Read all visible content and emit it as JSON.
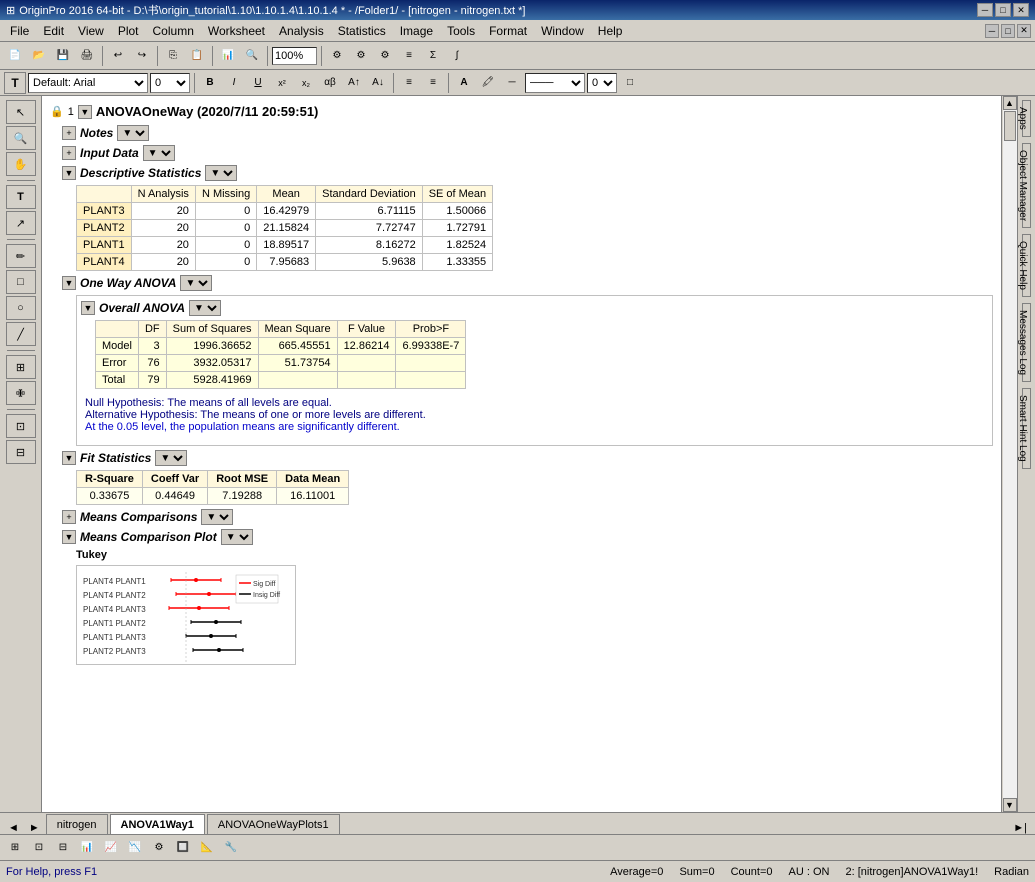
{
  "titlebar": {
    "title": "OriginPro 2016 64-bit - D:\\书\\origin_tutorial\\1.10\\1.10.1.4\\1.10.1.4 * - /Folder1/ - [nitrogen - nitrogen.txt *]",
    "app_icon": "⊞",
    "minimize": "─",
    "maximize": "□",
    "close": "✕"
  },
  "menubar": {
    "items": [
      "File",
      "Edit",
      "View",
      "Plot",
      "Column",
      "Worksheet",
      "Analysis",
      "Statistics",
      "Image",
      "Tools",
      "Format",
      "Window",
      "Help"
    ]
  },
  "toolbar": {
    "zoom_level": "100%",
    "font_name": "Default: Arial",
    "font_size": "0"
  },
  "report": {
    "title": "ANOVAOneWay (2020/7/11 20:59:51)",
    "sections": {
      "notes": {
        "label": "Notes"
      },
      "input_data": {
        "label": "Input Data"
      },
      "descriptive_statistics": {
        "label": "Descriptive Statistics",
        "columns": [
          "N Analysis",
          "N Missing",
          "Mean",
          "Standard Deviation",
          "SE of Mean"
        ],
        "rows": [
          {
            "name": "PLANT3",
            "n_analysis": 20,
            "n_missing": 0,
            "mean": "16.42979",
            "std_dev": "6.71115",
            "se_mean": "1.50066"
          },
          {
            "name": "PLANT2",
            "n_analysis": 20,
            "n_missing": 0,
            "mean": "21.15824",
            "std_dev": "7.72747",
            "se_mean": "1.72791"
          },
          {
            "name": "PLANT1",
            "n_analysis": 20,
            "n_missing": 0,
            "mean": "18.89517",
            "std_dev": "8.16272",
            "se_mean": "1.82524"
          },
          {
            "name": "PLANT4",
            "n_analysis": 20,
            "n_missing": 0,
            "mean": "7.95683",
            "std_dev": "5.9638",
            "se_mean": "1.33355"
          }
        ]
      },
      "one_way_anova": {
        "label": "One Way ANOVA",
        "overall_anova": {
          "label": "Overall ANOVA",
          "columns": [
            "DF",
            "Sum of Squares",
            "Mean Square",
            "F Value",
            "Prob>F"
          ],
          "rows": [
            {
              "name": "Model",
              "df": 3,
              "sum_sq": "1996.36652",
              "mean_sq": "665.45551",
              "f_value": "12.86214",
              "prob_f": "6.99338E-7"
            },
            {
              "name": "Error",
              "df": 76,
              "sum_sq": "3932.05317",
              "mean_sq": "51.73754",
              "f_value": "",
              "prob_f": ""
            },
            {
              "name": "Total",
              "df": 79,
              "sum_sq": "5928.41969",
              "mean_sq": "",
              "f_value": "",
              "prob_f": ""
            }
          ]
        },
        "hypothesis": {
          "null": "Null Hypothesis: The means of all levels are equal.",
          "alternative": "Alternative Hypothesis: The means of one or more levels are different.",
          "conclusion": "At the 0.05 level, the population means are significantly different."
        }
      },
      "fit_statistics": {
        "label": "Fit Statistics",
        "columns": [
          "R-Square",
          "Coeff Var",
          "Root MSE",
          "Data Mean"
        ],
        "values": [
          "0.33675",
          "0.44649",
          "7.19288",
          "16.11001"
        ]
      },
      "means_comparisons": {
        "label": "Means Comparisons"
      },
      "means_comparison_plot": {
        "label": "Means Comparison Plot",
        "method": "Tukey",
        "plot_labels": [
          "PLANT4 PLANT1",
          "PLANT4 PLANT2",
          "PLANT4 PLANT3",
          "PLANT1 PLANT2",
          "PLANT1 PLANT3",
          "PLANT2 PLANT3"
        ]
      }
    }
  },
  "tabs": {
    "items": [
      "nitrogen",
      "ANOVA1Way1",
      "ANOVAOneWayPlots1"
    ],
    "active": "ANOVA1Way1"
  },
  "status": {
    "help_text": "For Help, press F1",
    "average": "Average=0",
    "sum": "Sum=0",
    "count": "Count=0",
    "au": "AU : ON",
    "sheet": "2: [nitrogen]ANOVA1Way1!",
    "angle": "Radian"
  },
  "side_labels": {
    "apps": "Apps",
    "object_manager": "Object Manager",
    "quick_help": "Quick Help",
    "messages_log": "Messages Log",
    "smart_hint_log": "Smart Hint Log"
  }
}
